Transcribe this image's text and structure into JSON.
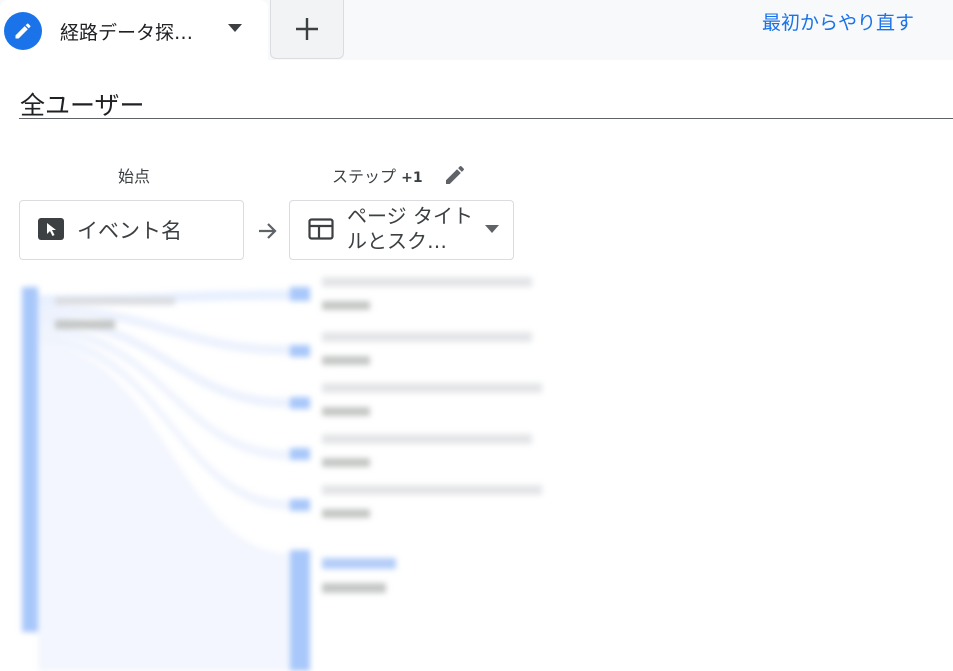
{
  "tabs": {
    "active_label": "経路データ探…",
    "add_icon": "plus-icon",
    "edit_icon": "pencil-icon"
  },
  "header": {
    "restart_link": "最初からやり直す"
  },
  "segment": {
    "title": "全ユーザー"
  },
  "columns": {
    "start_label": "始点",
    "step_label": "ステップ",
    "step_number": "+1"
  },
  "start_node": {
    "icon": "cursor-event-icon",
    "label": "イベント名"
  },
  "step_node": {
    "icon": "page-screen-icon",
    "label": "ページ タイトルとスク…"
  },
  "colors": {
    "accent": "#1a73e8",
    "node_bar": "#a8c7fa",
    "flow": "#e8f0fe"
  }
}
